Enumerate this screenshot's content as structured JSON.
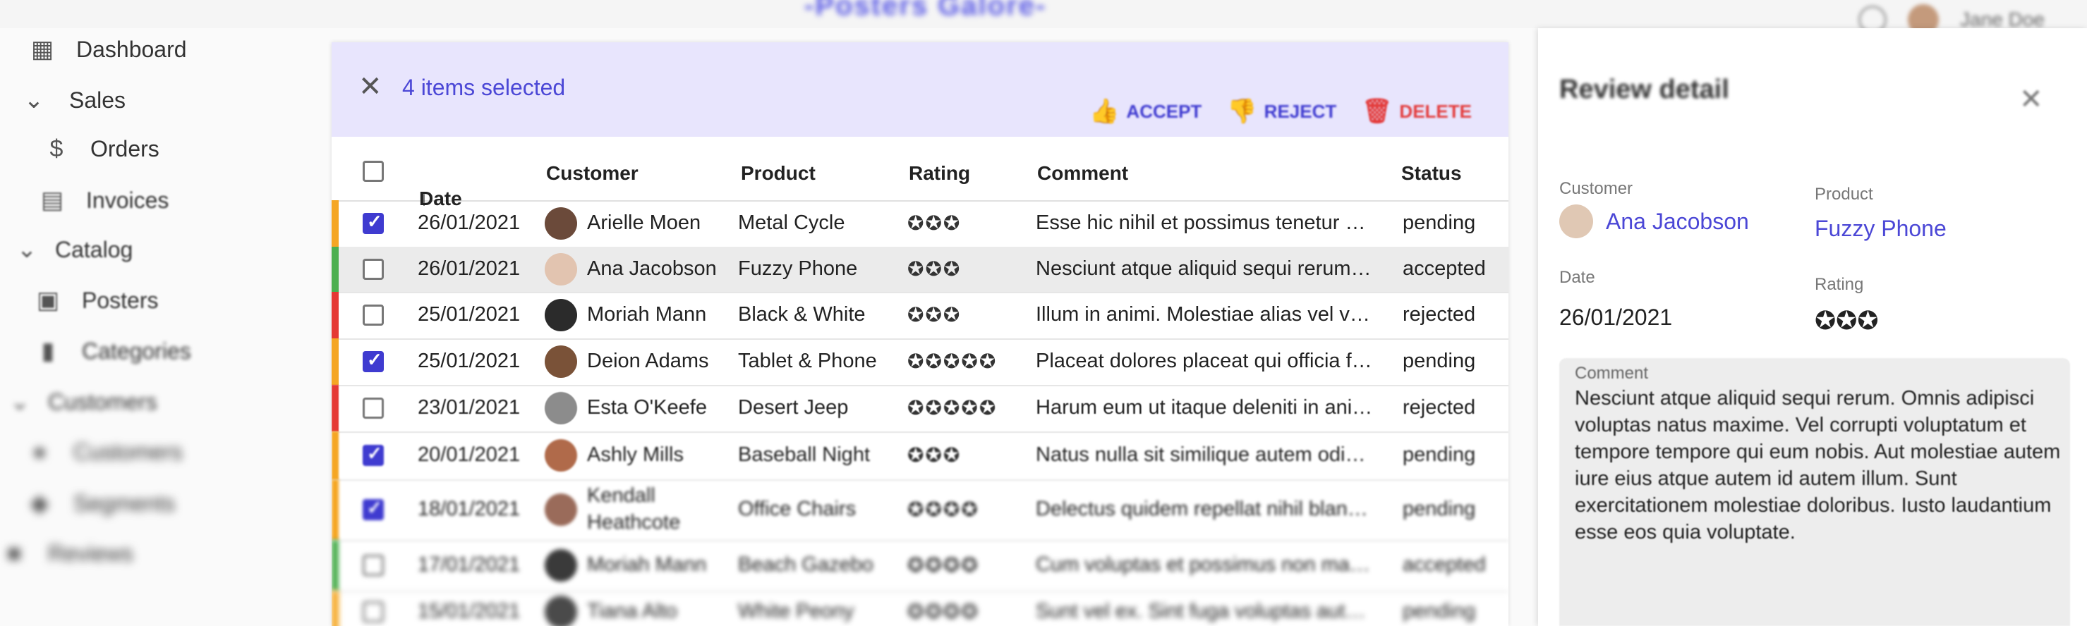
{
  "app": {
    "title": "-Posters Galore-",
    "user_name": "Jane Doe"
  },
  "sidebar": {
    "items": [
      {
        "label": "Dashboard",
        "icon": "dashboard-icon"
      },
      {
        "label": "Sales",
        "icon": "chevron-down-icon"
      },
      {
        "label": "Orders",
        "icon": "dollar-icon"
      },
      {
        "label": "Invoices",
        "icon": "invoices-icon"
      },
      {
        "label": "Catalog",
        "icon": "chevron-down-icon"
      },
      {
        "label": "Posters",
        "icon": "posters-icon"
      },
      {
        "label": "Categories",
        "icon": "bookmark-icon"
      },
      {
        "label": "Customers",
        "icon": "chevron-down-icon"
      },
      {
        "label": "Customers",
        "icon": "people-icon"
      },
      {
        "label": "Segments",
        "icon": "label-icon"
      },
      {
        "label": "Reviews",
        "icon": "comment-icon"
      }
    ]
  },
  "bulk": {
    "selected_text": "4 items selected",
    "accept": "ACCEPT",
    "reject": "REJECT",
    "delete": "DELETE"
  },
  "table": {
    "columns": [
      "Date",
      "Customer",
      "Product",
      "Rating",
      "Comment",
      "Status"
    ],
    "sort_icon": "arrow-down-icon",
    "status_colors": {
      "pending": "#f5a623",
      "accepted": "#4caf50",
      "rejected": "#e53935"
    },
    "rows": [
      {
        "checked": true,
        "date": "26/01/2021",
        "customer": "Arielle Moen",
        "product": "Metal Cycle",
        "rating": 3,
        "comment": "Esse hic nihil et possimus tenetur dol...",
        "status": "pending"
      },
      {
        "checked": false,
        "date": "26/01/2021",
        "customer": "Ana Jacobson",
        "product": "Fuzzy Phone",
        "rating": 3,
        "comment": "Nesciunt atque aliquid sequi rerum. O...",
        "status": "accepted"
      },
      {
        "checked": false,
        "date": "25/01/2021",
        "customer": "Moriah Mann",
        "product": "Black & White",
        "rating": 3,
        "comment": "Illum in animi. Molestiae alias vel velit...",
        "status": "rejected"
      },
      {
        "checked": true,
        "date": "25/01/2021",
        "customer": "Deion Adams",
        "product": "Tablet & Phone",
        "rating": 5,
        "comment": "Placeat dolores placeat qui officia fug...",
        "status": "pending"
      },
      {
        "checked": false,
        "date": "23/01/2021",
        "customer": "Esta O'Keefe",
        "product": "Desert Jeep",
        "rating": 5,
        "comment": "Harum eum ut itaque deleniti in animi ...",
        "status": "rejected"
      },
      {
        "checked": true,
        "date": "20/01/2021",
        "customer": "Ashly Mills",
        "product": "Baseball Night",
        "rating": 3,
        "comment": "Natus nulla sit similique autem odio i...",
        "status": "pending"
      },
      {
        "checked": true,
        "date": "18/01/2021",
        "customer": "Kendall Heathcote",
        "product": "Office Chairs",
        "rating": 4,
        "comment": "Delectus quidem repellat nihil blanditi...",
        "status": "pending"
      },
      {
        "checked": false,
        "date": "17/01/2021",
        "customer": "Moriah Mann",
        "product": "Beach Gazebo",
        "rating": 4,
        "comment": "Cum voluptas et possimus non magni...",
        "status": "accepted"
      },
      {
        "checked": false,
        "date": "15/01/2021",
        "customer": "Tiana Alto",
        "product": "White Peony",
        "rating": 4,
        "comment": "Sunt vel ex. Sint fuga voluptas autem...",
        "status": "pending"
      }
    ]
  },
  "detail": {
    "title": "Review detail",
    "customer_label": "Customer",
    "customer": "Ana Jacobson",
    "product_label": "Product",
    "product": "Fuzzy Phone",
    "date_label": "Date",
    "date": "26/01/2021",
    "rating_label": "Rating",
    "rating": 3,
    "comment_label": "Comment",
    "comment": "Nesciunt atque aliquid sequi rerum. Omnis adipisci voluptas natus maxime. Vel corrupti voluptatum et tempore tempore qui eum nobis. Aut molestiae autem iure eius atque autem id autem illum. Sunt exercitationem molestiae doloribus. Iusto laudantium esse eos quia voluptate."
  }
}
